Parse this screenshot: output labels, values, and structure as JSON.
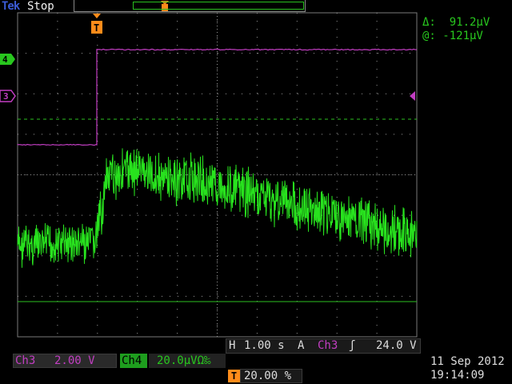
{
  "header": {
    "brand": "Tek",
    "run_status": "Stop"
  },
  "cursor_readout": {
    "delta": "Δ:  91.2µV",
    "at": "@: -121µV"
  },
  "channel_markers": {
    "ch4": "4",
    "ch3": "3",
    "trigger_marker": "T"
  },
  "channels": {
    "ch3": {
      "label": "Ch3",
      "scale": "2.00 V"
    },
    "ch4": {
      "label": "Ch4",
      "scale": "20.0µVΩ‰"
    }
  },
  "horizontal": {
    "label": "H",
    "scale": "1.00 s",
    "trigger_mode": "A",
    "trigger_source": "Ch3",
    "slope_icon": "rising-edge-icon",
    "slope_glyph": "ʃ",
    "trigger_level": "24.0 V"
  },
  "trigger_position": {
    "icon": "T",
    "value": "20.00 %"
  },
  "datetime": {
    "date": "11 Sep 2012",
    "time": "19:14:09"
  },
  "colors": {
    "ch3": "#c23ec2",
    "ch4": "#28c71e",
    "trigger": "#ff8c1a",
    "grid": "#9a9a9a"
  }
}
